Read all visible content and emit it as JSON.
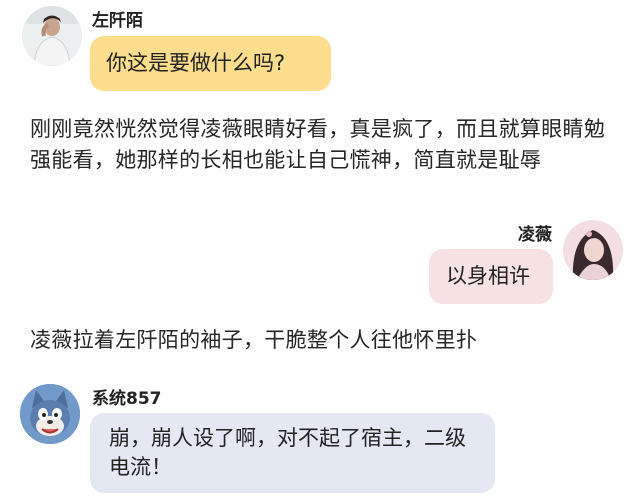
{
  "messages": [
    {
      "sender": "左阡陌",
      "text": "你这是要做什么吗?",
      "bubble_color": "#fcdd8e",
      "align": "left"
    },
    {
      "sender": "凌薇",
      "text": "以身相许",
      "bubble_color": "#f6e1e3",
      "align": "right"
    },
    {
      "sender": "系统857",
      "text": "崩，崩人设了啊，对不起了宿主，二级电流！",
      "bubble_color": "#e3e8f2",
      "align": "left"
    }
  ],
  "narrations": [
    "刚刚竟然恍然觉得凌薇眼睛好看，真是疯了，而且就算眼睛勉强能看，她那样的长相也能让自己慌神，简直就是耻辱",
    "凌薇拉着左阡陌的袖子，干脆整个人往他怀里扑"
  ],
  "colors": {
    "yellow_bubble": "#fcdd8e",
    "pink_bubble": "#f6e1e3",
    "blue_bubble": "#e3e8f2"
  }
}
